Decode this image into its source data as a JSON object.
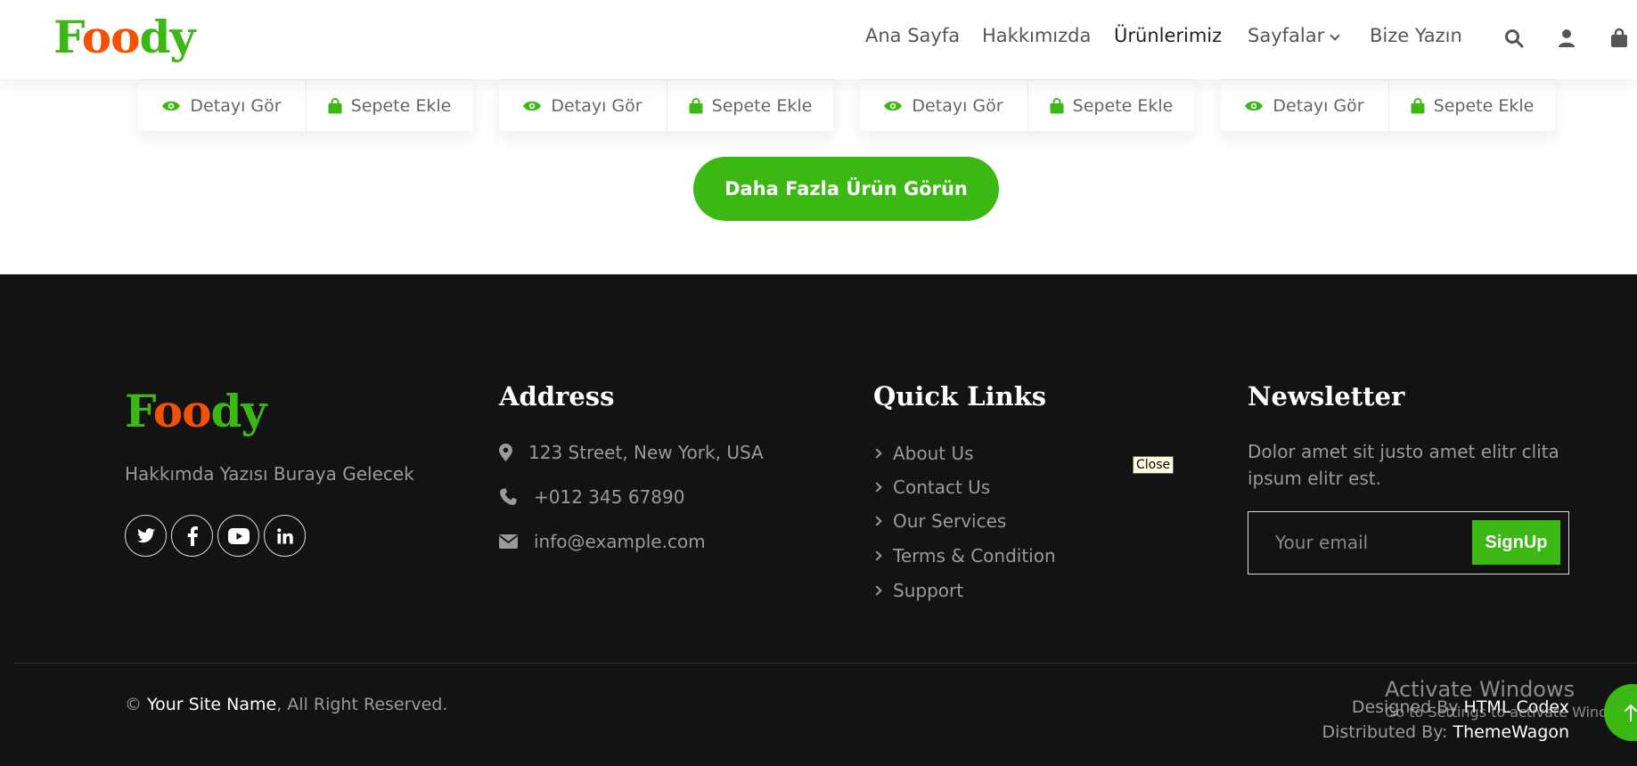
{
  "brand": {
    "logo_part1": "F",
    "logo_part2": "oo",
    "logo_part3": "dy",
    "green": "#3cb815",
    "orange": "#f65005"
  },
  "nav": {
    "items": [
      {
        "label": "Ana Sayfa"
      },
      {
        "label": "Hakkımızda"
      },
      {
        "label": "Ürünlerimiz"
      },
      {
        "label": "Sayfalar"
      },
      {
        "label": "Bize Yazın"
      }
    ],
    "icons": [
      "search-icon",
      "user-icon",
      "shopping-bag-icon"
    ]
  },
  "products": {
    "detail_label": "Detayı Gör",
    "cart_label": "Sepete Ekle",
    "more_button": "Daha Fazla Ürün Görün"
  },
  "footer": {
    "about": "Hakkımda Yazısı Buraya Gelecek",
    "social_icons": [
      "twitter-icon",
      "facebook-icon",
      "youtube-icon",
      "linkedin-icon"
    ],
    "address_title": "Address",
    "address": "123 Street, New York, USA",
    "phone": "+012 345 67890",
    "email": "info@example.com",
    "links_title": "Quick Links",
    "links": [
      "About Us",
      "Contact Us",
      "Our Services",
      "Terms & Condition",
      "Support"
    ],
    "newsletter_title": "Newsletter",
    "newsletter_text": "Dolor amet sit justo amet elitr clita ipsum elitr est.",
    "email_placeholder": "Your email",
    "signup_label": "SignUp",
    "copyright_prefix": "©",
    "site_name": "Your Site Name",
    "copyright_suffix": ", All Right Reserved.",
    "designed_prefix": "Designed By",
    "designed_by": "HTML Codex",
    "distributed_prefix": "Distributed By:",
    "distributed_by": "ThemeWagon"
  },
  "tooltip": {
    "close": "Close"
  },
  "watermark": {
    "line1": "Activate Windows",
    "line2": "Go to Settings to activate Windows."
  }
}
